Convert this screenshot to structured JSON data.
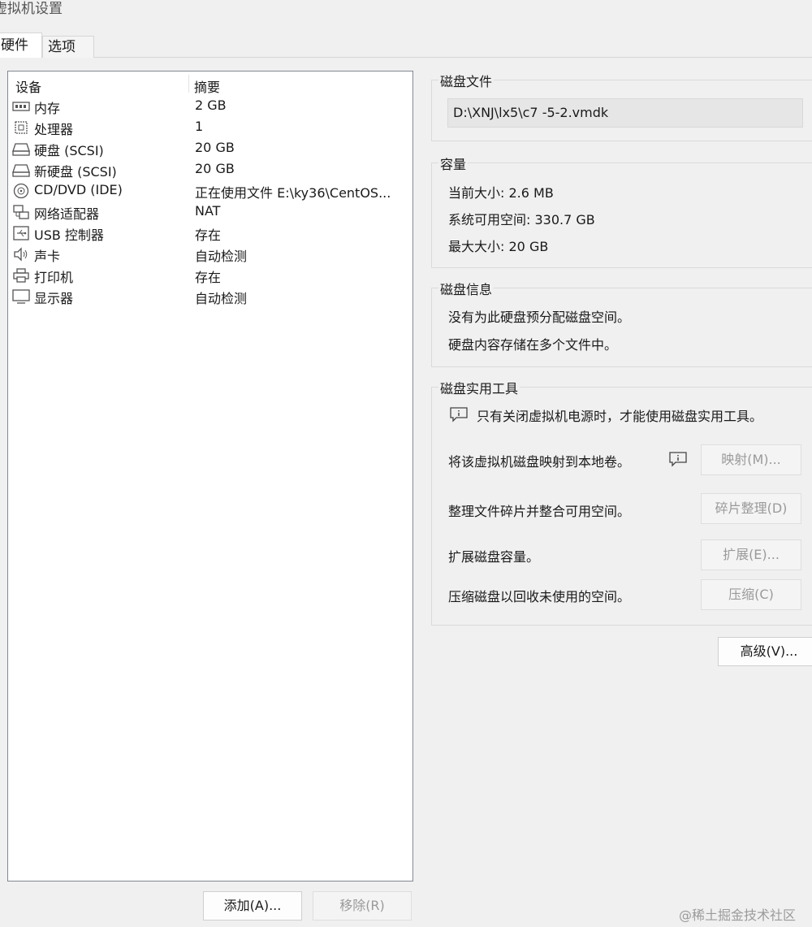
{
  "window": {
    "title": "虚拟机设置"
  },
  "tabs": [
    {
      "label": "硬件"
    },
    {
      "label": "选项"
    }
  ],
  "device_list": {
    "headers": {
      "device": "设备",
      "summary": "摘要"
    },
    "rows": [
      {
        "name": "内存",
        "summary": "2 GB",
        "icon": "memory-icon"
      },
      {
        "name": "处理器",
        "summary": "1",
        "icon": "cpu-icon"
      },
      {
        "name": "硬盘 (SCSI)",
        "summary": "20 GB",
        "icon": "hard-disk-icon"
      },
      {
        "name": "新硬盘 (SCSI)",
        "summary": "20 GB",
        "icon": "hard-disk-icon"
      },
      {
        "name": "CD/DVD (IDE)",
        "summary": "正在使用文件 E:\\ky36\\CentOS...",
        "icon": "cd-dvd-icon"
      },
      {
        "name": "网络适配器",
        "summary": "NAT",
        "icon": "network-adapter-icon"
      },
      {
        "name": "USB 控制器",
        "summary": "存在",
        "icon": "usb-icon"
      },
      {
        "name": "声卡",
        "summary": "自动检测",
        "icon": "speaker-icon"
      },
      {
        "name": "打印机",
        "summary": "存在",
        "icon": "printer-icon"
      },
      {
        "name": "显示器",
        "summary": "自动检测",
        "icon": "display-icon"
      }
    ]
  },
  "bottom_buttons": {
    "add": "添加(A)...",
    "remove": "移除(R)"
  },
  "disk_file": {
    "title": "磁盘文件",
    "value": "D:\\XNJ\\lx5\\c7 -5-2.vmdk"
  },
  "capacity": {
    "title": "容量",
    "current_size_label": "当前大小:",
    "current_size_value": "2.6 MB",
    "available_label": "系统可用空间:",
    "available_value": "330.7 GB",
    "max_size_label": "最大大小:",
    "max_size_value": "20 GB"
  },
  "disk_info": {
    "title": "磁盘信息",
    "line1": "没有为此硬盘预分配磁盘空间。",
    "line2": "硬盘内容存储在多个文件中。"
  },
  "disk_utilities": {
    "title": "磁盘实用工具",
    "notice": "只有关闭虚拟机电源时，才能使用磁盘实用工具。",
    "map_text": "将该虚拟机磁盘映射到本地卷。",
    "map_button": "映射(M)...",
    "defrag_text": "整理文件碎片并整合可用空间。",
    "defrag_button": "碎片整理(D)",
    "expand_text": "扩展磁盘容量。",
    "expand_button": "扩展(E)...",
    "compact_text": "压缩磁盘以回收未使用的空间。",
    "compact_button": "压缩(C)"
  },
  "advanced_button": "高级(V)...",
  "watermark": "@稀土掘金技术社区"
}
